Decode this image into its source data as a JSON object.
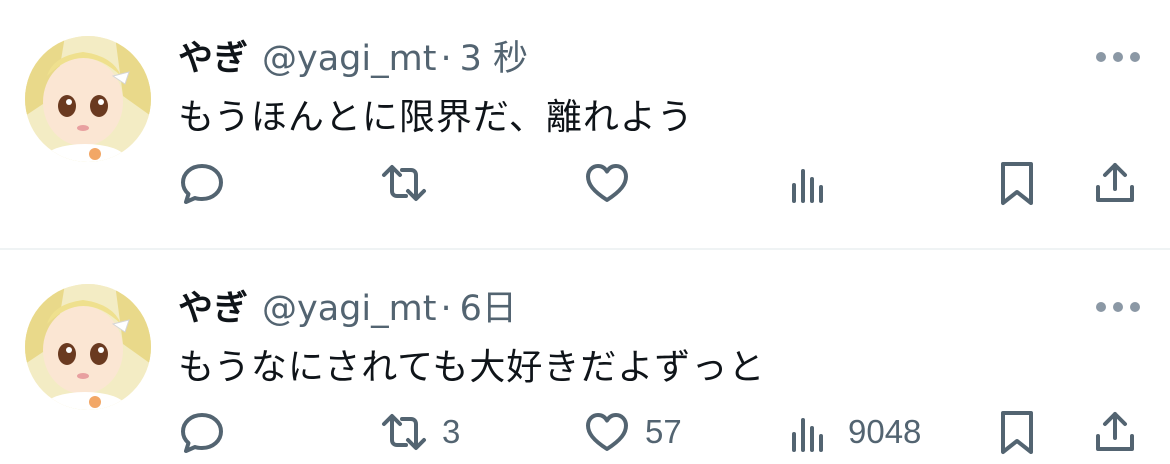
{
  "tweets": [
    {
      "display_name": "やぎ",
      "handle": "@yagi_mt",
      "separator": "·",
      "time": "3 秒",
      "text": "もうほんとに限界だ、離れよう",
      "retweets": "",
      "likes": "",
      "views": ""
    },
    {
      "display_name": "やぎ",
      "handle": "@yagi_mt",
      "separator": "·",
      "time": "6日",
      "text": "もうなにされても大好きだよずっと",
      "retweets": "3",
      "likes": "57",
      "views": "9048"
    }
  ],
  "icons": {
    "reply": "reply-icon",
    "retweet": "retweet-icon",
    "like": "heart-icon",
    "views": "analytics-icon",
    "bookmark": "bookmark-icon",
    "share": "share-icon",
    "more": "more-icon"
  },
  "colors": {
    "text_primary": "#0f1419",
    "text_secondary": "#536471",
    "divider": "#eff3f4"
  }
}
